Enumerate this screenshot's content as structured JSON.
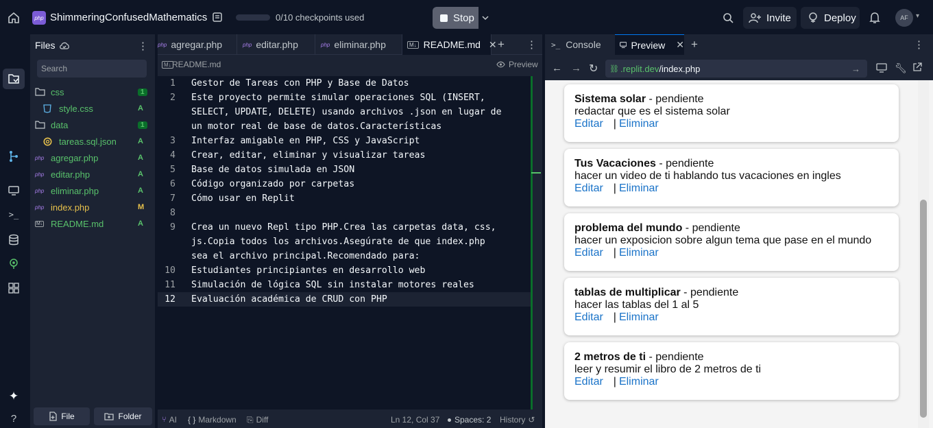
{
  "topbar": {
    "app_name": "ShimmeringConfusedMathematics",
    "logo_text": "php",
    "checkpoints": "0/10 checkpoints used",
    "stop_label": "Stop",
    "invite_label": "Invite",
    "deploy_label": "Deploy",
    "avatar_initials": "AF"
  },
  "files_panel": {
    "title": "Files",
    "search_placeholder": "Search",
    "items": [
      {
        "label": "css",
        "type": "folder",
        "badge": "1",
        "color": "#59c26b"
      },
      {
        "label": "style.css",
        "type": "css",
        "badge": "A",
        "color": "#59c26b"
      },
      {
        "label": "data",
        "type": "folder",
        "badge": "1",
        "color": "#59c26b"
      },
      {
        "label": "tareas.sql.json",
        "type": "json",
        "badge": "A",
        "color": "#59c26b"
      },
      {
        "label": "agregar.php",
        "type": "php",
        "badge": "A",
        "color": "#59c26b"
      },
      {
        "label": "editar.php",
        "type": "php",
        "badge": "A",
        "color": "#59c26b"
      },
      {
        "label": "eliminar.php",
        "type": "php",
        "badge": "A",
        "color": "#59c26b"
      },
      {
        "label": "index.php",
        "type": "php",
        "badge": "M",
        "color": "#e6c04b"
      },
      {
        "label": "README.md",
        "type": "md",
        "badge": "A",
        "color": "#59c26b"
      }
    ],
    "file_button": "File",
    "folder_button": "Folder"
  },
  "editor": {
    "tabs": [
      {
        "label": "agregar.php",
        "icon": "php"
      },
      {
        "label": "editar.php",
        "icon": "php"
      },
      {
        "label": "eliminar.php",
        "icon": "php"
      },
      {
        "label": "README.md",
        "icon": "M↓"
      }
    ],
    "breadcrumb": "README.md",
    "preview_label": "Preview",
    "lines": [
      {
        "num": "1",
        "text": "Gestor de Tareas con PHP y Base de Datos"
      },
      {
        "num": "2",
        "text": "Este proyecto permite simular operaciones SQL (INSERT,"
      },
      {
        "num": "",
        "text": "SELECT, UPDATE, DELETE) usando archivos .json en lugar de"
      },
      {
        "num": "",
        "text": "un motor real de base de datos.Características"
      },
      {
        "num": "3",
        "text": "Interfaz amigable en PHP, CSS y JavaScript"
      },
      {
        "num": "4",
        "text": "Crear, editar, eliminar y visualizar tareas"
      },
      {
        "num": "5",
        "text": "Base de datos simulada en JSON"
      },
      {
        "num": "6",
        "text": "Código organizado por carpetas"
      },
      {
        "num": "7",
        "text": "Cómo usar en Replit"
      },
      {
        "num": "8",
        "text": ""
      },
      {
        "num": "9",
        "text": "Crea un nuevo Repl tipo PHP.Crea las carpetas data, css,"
      },
      {
        "num": "",
        "text": "js.Copia todos los archivos.Asegúrate de que index.php"
      },
      {
        "num": "",
        "text": "sea el archivo principal.Recomendado para:"
      },
      {
        "num": "10",
        "text": "Estudiantes principiantes en desarrollo web"
      },
      {
        "num": "11",
        "text": "Simulación de lógica SQL sin instalar motores reales"
      },
      {
        "num": "12",
        "text": "Evaluación académica de CRUD con PHP"
      }
    ],
    "status": {
      "ai": "AI",
      "mode": "Markdown",
      "diff": "Diff",
      "position": "Ln 12, Col 37",
      "spaces": "Spaces: 2",
      "history": "History"
    }
  },
  "right_pane": {
    "tabs": [
      {
        "label": "Console"
      },
      {
        "label": "Preview"
      }
    ],
    "url_host": ".replit.dev",
    "url_path": "/index.php",
    "tasks": [
      {
        "title": "Sistema solar",
        "status": " - pendiente",
        "desc": "redactar que es el sistema solar"
      },
      {
        "title": "Tus Vacaciones",
        "status": " - pendiente",
        "desc": "hacer un video de ti hablando tus vacaciones en ingles"
      },
      {
        "title": "problema del mundo",
        "status": " - pendiente",
        "desc": "hacer un exposicion sobre algun tema que pase en el mundo"
      },
      {
        "title": "tablas de multiplicar",
        "status": " - pendiente",
        "desc": "hacer las tablas del 1 al 5"
      },
      {
        "title": "2 metros de ti",
        "status": " - pendiente",
        "desc": "leer y resumir el libro de 2 metros de ti"
      }
    ],
    "edit_label": "Editar",
    "separator": "|",
    "delete_label": "Eliminar"
  }
}
